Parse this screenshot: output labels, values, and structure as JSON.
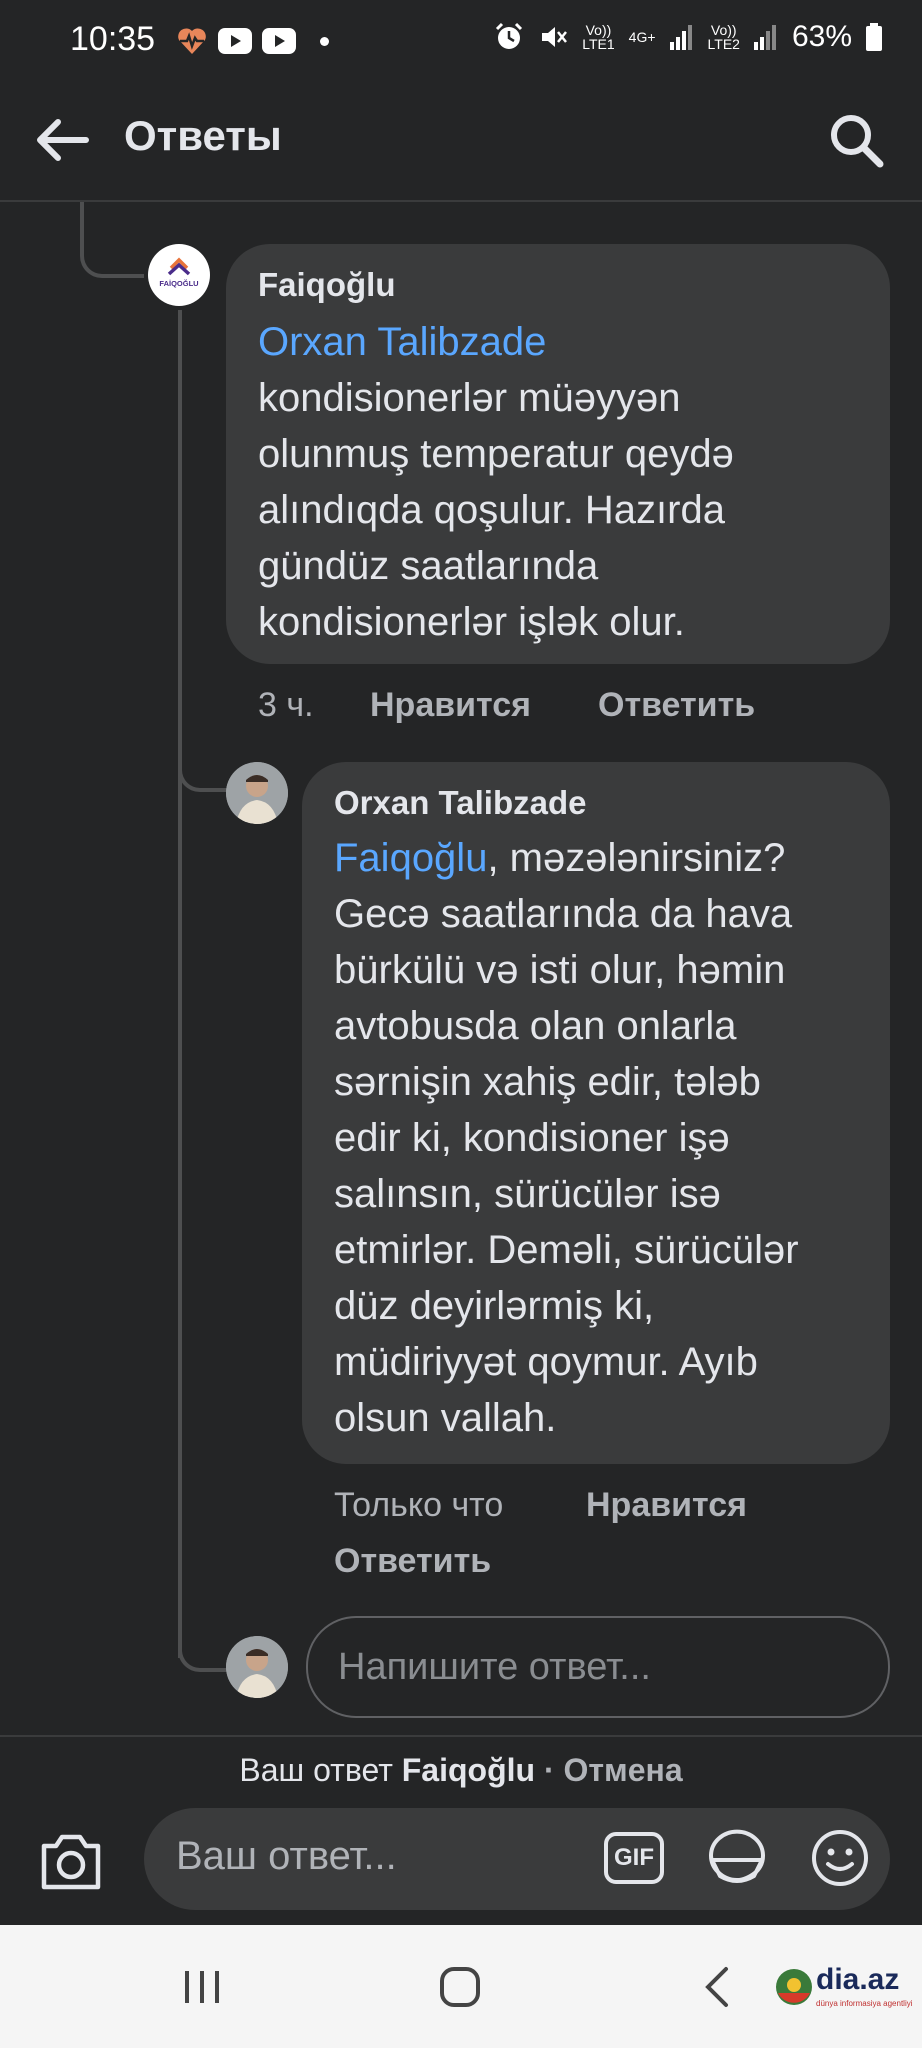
{
  "status_bar": {
    "time": "10:35",
    "battery": "63%",
    "sim1": "LTE1",
    "sim2": "LTE2",
    "net": "4G+",
    "volte": "Vo))"
  },
  "header": {
    "title": "Ответы",
    "back_icon": "arrow-left-icon",
    "search_icon": "search-icon"
  },
  "comments": [
    {
      "author": "Faiqoğlu",
      "avatar_text": "FAİQOĞLU",
      "mention": "Orxan Talibzade",
      "text_lines": [
        "kondisionerlər müəyyən",
        "olunmuş temperatur qeydə",
        "alındıqda qoşulur. Hazırda",
        "gündüz saatlarında",
        "kondisionerlər işlək olur."
      ],
      "time": "3 ч.",
      "like": "Нравится",
      "reply": "Ответить"
    },
    {
      "author": "Orxan Talibzade",
      "mention": "Faiqoğlu",
      "mention_suffix": ", məzələnirsiniz?",
      "text_lines": [
        "Gecə saatlarında da hava",
        "bürkülü və isti olur, həmin",
        "avtobusda olan onlarla",
        "sərnişin xahiş edir, tələb",
        "edir ki, kondisioner işə",
        "salınsın, sürücülər isə",
        "etmirlər. Deməli, sürücülər",
        "düz deyirlərmiş ki,",
        "müdiriyyət qoymur. Ayıb",
        "olsun vallah."
      ],
      "time": "Только что",
      "like": "Нравится",
      "reply": "Ответить"
    }
  ],
  "reply_field": {
    "placeholder": "Напишите ответ..."
  },
  "composer": {
    "reply_prefix": "Ваш ответ",
    "reply_target": "Faiqoğlu",
    "separator": "·",
    "cancel": "Отмена",
    "placeholder": "Ваш ответ...",
    "gif_label": "GIF"
  },
  "watermark": {
    "brand": "dia.az",
    "tagline": "dünya informasiya agentliyi"
  },
  "colors": {
    "background": "#242526",
    "bubble": "#3a3b3c",
    "mention": "#5aa7ff",
    "secondary_text": "#b0b3b8"
  }
}
